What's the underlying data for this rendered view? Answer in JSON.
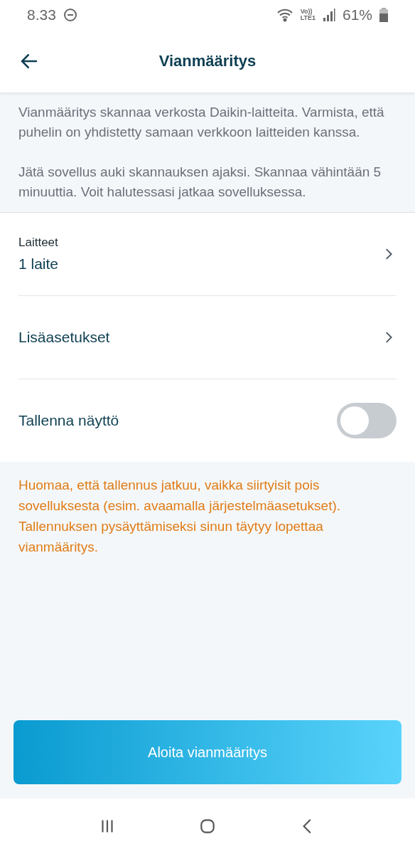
{
  "status_bar": {
    "time": "8.33",
    "volte": "Vo))",
    "network": "LTE1",
    "battery": "61%"
  },
  "header": {
    "title": "Vianmääritys"
  },
  "info": [
    "Vianmääritys skannaa verkosta Daikin-laitteita. Varmista, että puhelin on yhdistetty samaan verkkoon laitteiden kanssa.",
    "Jätä sovellus auki skannauksen ajaksi. Skannaa vähintään 5 minuuttia. Voit halutessasi jatkaa sovelluksessa."
  ],
  "settings": [
    {
      "kind": "link",
      "caption": "Laitteet",
      "label": "1 laite"
    },
    {
      "kind": "link",
      "label": "Lisäasetukset"
    },
    {
      "kind": "toggle",
      "label": "Tallenna näyttö",
      "on": false
    }
  ],
  "warning": "Huomaa, että tallennus jatkuu, vaikka siirtyisit pois sovelluksesta (esim. avaamalla järjestelmäasetukset). Tallennuksen pysäyttämiseksi sinun täytyy lopettaa vianmääritys.",
  "primary_button": "Aloita vianmääritys"
}
